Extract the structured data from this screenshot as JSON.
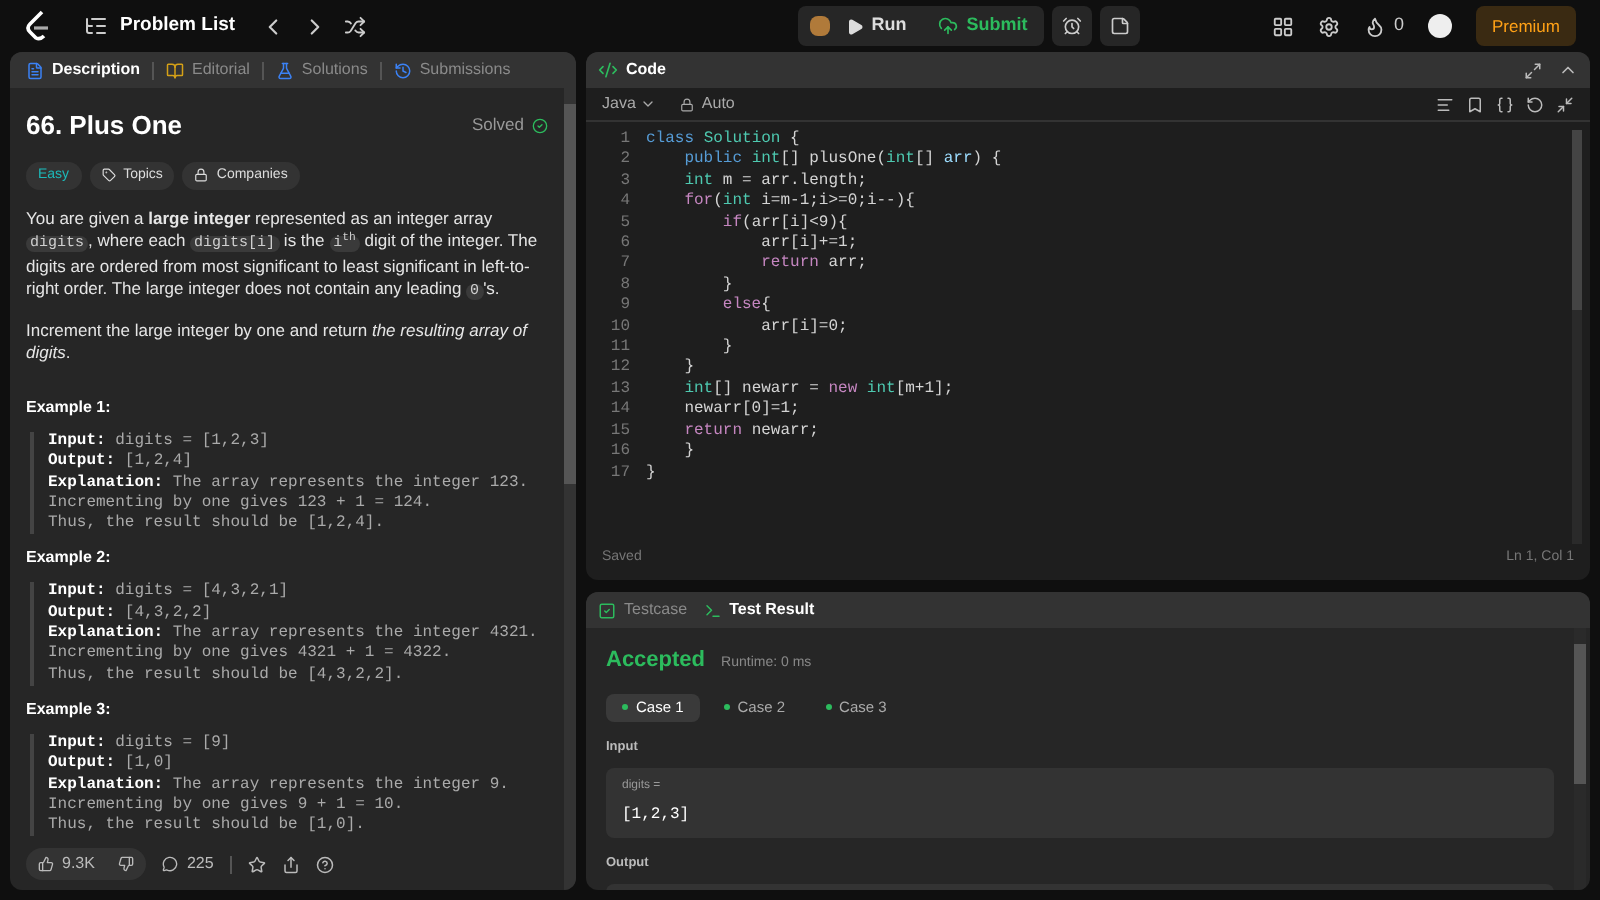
{
  "topbar": {
    "title": "Problem List",
    "run": "Run",
    "submit": "Submit",
    "streak": "0",
    "premium": "Premium"
  },
  "description_tabs": [
    {
      "label": "Description",
      "selected": true
    },
    {
      "label": "Editorial",
      "selected": false
    },
    {
      "label": "Solutions",
      "selected": false
    },
    {
      "label": "Submissions",
      "selected": false
    }
  ],
  "problem": {
    "title": "66. Plus One",
    "status": "Solved",
    "difficulty": "Easy",
    "tags": [
      "Topics",
      "Companies"
    ],
    "paragraphs": [
      [
        {
          "kind": "text",
          "text": "You are given a **large integer** represented as an integer array "
        },
        {
          "kind": "code",
          "text": "digits"
        },
        {
          "kind": "text",
          "text": ", where each "
        },
        {
          "kind": "code",
          "text": "digits[i]"
        },
        {
          "kind": "text",
          "text": " is the "
        },
        {
          "kind": "code",
          "text": "i$^{th}$"
        },
        {
          "kind": "text",
          "text": " digit of the integer. The digits are ordered from most significant to least significant in left-to-right order. The large integer does not contain any leading "
        },
        {
          "kind": "code",
          "text": "0"
        },
        {
          "kind": "text",
          "text": "'s."
        }
      ],
      [
        {
          "kind": "text",
          "text": "Increment the large integer by one and return *the resulting array of digits*."
        }
      ]
    ],
    "examples": [
      {
        "title": "Example 1:",
        "lines": [
          {
            "label": "Input:",
            "text": "digits = [1,2,3]"
          },
          {
            "label": "Output:",
            "text": "[1,2,4]"
          },
          {
            "label": "Explanation:",
            "text": "The array represents the integer 123."
          },
          {
            "text": "Incrementing by one gives 123 + 1 = 124."
          },
          {
            "text": "Thus, the result should be [1,2,4]."
          }
        ]
      },
      {
        "title": "Example 2:",
        "lines": [
          {
            "label": "Input:",
            "text": "digits = [4,3,2,1]"
          },
          {
            "label": "Output:",
            "text": "[4,3,2,2]"
          },
          {
            "label": "Explanation:",
            "text": "The array represents the integer 4321."
          },
          {
            "text": "Incrementing by one gives 4321 + 1 = 4322."
          },
          {
            "text": "Thus, the result should be [4,3,2,2]."
          }
        ]
      },
      {
        "title": "Example 3:",
        "lines": [
          {
            "label": "Input:",
            "text": "digits = [9]"
          },
          {
            "label": "Output:",
            "text": "[1,0]"
          },
          {
            "label": "Explanation:",
            "text": "The array represents the integer 9."
          },
          {
            "text": "Incrementing by one gives 9 + 1 = 10."
          },
          {
            "text": "Thus, the result should be [1,0]."
          }
        ]
      }
    ],
    "likes": "9.3K",
    "comments": "225"
  },
  "code_panel": {
    "title": "Code",
    "language": "Java",
    "mode": "Auto",
    "status": "Saved",
    "cursor": "Ln 1, Col 1",
    "lines": [
      {
        "number": "1",
        "tokens": [
          {
            "kind": "kw",
            "text": "class "
          },
          {
            "kind": "type",
            "text": "Solution"
          },
          {
            "kind": "plain",
            "text": " {"
          }
        ]
      },
      {
        "number": "2",
        "tokens": [
          {
            "kind": "kw",
            "text": "    public "
          },
          {
            "kind": "type",
            "text": "int"
          },
          {
            "kind": "plain",
            "text": "[] plusOne("
          },
          {
            "kind": "type",
            "text": "int"
          },
          {
            "kind": "plain",
            "text": "[] "
          },
          {
            "kind": "var",
            "text": "arr"
          },
          {
            "kind": "plain",
            "text": ") {"
          }
        ]
      },
      {
        "number": "3",
        "tokens": [
          {
            "kind": "type",
            "text": "    int"
          },
          {
            "kind": "plain",
            "text": " m = arr.length;"
          }
        ]
      },
      {
        "number": "4",
        "tokens": [
          {
            "kind": "ctrl",
            "text": "    for"
          },
          {
            "kind": "plain",
            "text": "("
          },
          {
            "kind": "type",
            "text": "int"
          },
          {
            "kind": "plain",
            "text": " i=m-1;i>=0;i--){"
          }
        ]
      },
      {
        "number": "5",
        "tokens": [
          {
            "kind": "ctrl",
            "text": "        if"
          },
          {
            "kind": "plain",
            "text": "(arr[i]<9){"
          }
        ]
      },
      {
        "number": "6",
        "tokens": [
          {
            "kind": "plain",
            "text": "            arr[i]+=1;"
          }
        ]
      },
      {
        "number": "7",
        "tokens": [
          {
            "kind": "ctrl",
            "text": "            return"
          },
          {
            "kind": "plain",
            "text": " arr;"
          }
        ]
      },
      {
        "number": "8",
        "tokens": [
          {
            "kind": "plain",
            "text": "        }"
          }
        ]
      },
      {
        "number": "9",
        "tokens": [
          {
            "kind": "ctrl",
            "text": "        else"
          },
          {
            "kind": "plain",
            "text": "{"
          }
        ]
      },
      {
        "number": "10",
        "tokens": [
          {
            "kind": "plain",
            "text": "            arr[i]=0;"
          }
        ]
      },
      {
        "number": "11",
        "tokens": [
          {
            "kind": "plain",
            "text": "        }"
          }
        ]
      },
      {
        "number": "12",
        "tokens": [
          {
            "kind": "plain",
            "text": "    }"
          }
        ]
      },
      {
        "number": "13",
        "tokens": [
          {
            "kind": "type",
            "text": "    int"
          },
          {
            "kind": "plain",
            "text": "[] newarr = "
          },
          {
            "kind": "ctrl",
            "text": "new "
          },
          {
            "kind": "type",
            "text": "int"
          },
          {
            "kind": "plain",
            "text": "[m+1];"
          }
        ]
      },
      {
        "number": "14",
        "tokens": [
          {
            "kind": "plain",
            "text": "    newarr[0]=1;"
          }
        ]
      },
      {
        "number": "15",
        "tokens": [
          {
            "kind": "ctrl",
            "text": "    return"
          },
          {
            "kind": "plain",
            "text": " newarr;"
          }
        ]
      },
      {
        "number": "16",
        "tokens": [
          {
            "kind": "plain",
            "text": "    }"
          }
        ]
      },
      {
        "number": "17",
        "tokens": [
          {
            "kind": "plain",
            "text": "}"
          }
        ]
      }
    ]
  },
  "result_tabs": [
    {
      "label": "Testcase",
      "selected": false
    },
    {
      "label": "Test Result",
      "selected": true
    }
  ],
  "result": {
    "verdict": "Accepted",
    "runtime": "Runtime: 0 ms",
    "cases": [
      {
        "label": "Case 1",
        "selected": true
      },
      {
        "label": "Case 2",
        "selected": false
      },
      {
        "label": "Case 3",
        "selected": false
      }
    ],
    "input_label": "Input",
    "input_name": "digits =",
    "input_value": "[1,2,3]",
    "output_label": "Output"
  }
}
